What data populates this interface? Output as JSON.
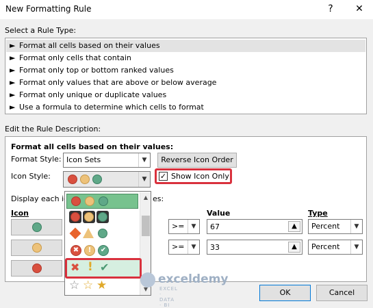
{
  "window": {
    "title": "New Formatting Rule",
    "help_glyph": "?",
    "close_glyph": "✕"
  },
  "rule_type": {
    "label": "Select a Rule Type:",
    "items": [
      "Format all cells based on their values",
      "Format only cells that contain",
      "Format only top or bottom ranked values",
      "Format only values that are above or below average",
      "Format only unique or duplicate values",
      "Use a formula to determine which cells to format"
    ],
    "arrow": "►",
    "selected_index": 0
  },
  "description": {
    "label": "Edit the Rule Description:",
    "heading": "Format all cells based on their values:",
    "format_style_label": "Format Style:",
    "format_style_value": "Icon Sets",
    "reverse_button": "Reverse Icon Order",
    "icon_style_label": "Icon Style:",
    "show_icon_only_label": "Show Icon Only",
    "show_icon_only_checked": true,
    "check_glyph": "✓",
    "display_partial_left": "Display each ic",
    "display_partial_right": "es:",
    "icon_col": "Icon",
    "value_col": "Value",
    "type_col": "Type",
    "rows": [
      {
        "op": ">=",
        "value": "67",
        "type": "Percent"
      },
      {
        "op": ">=",
        "value": "33",
        "type": "Percent"
      }
    ]
  },
  "icon_popup": {
    "options": [
      "3 Traffic Lights (Unrimmed)",
      "3 Traffic Lights (Rimmed)",
      "3 Signs",
      "3 Symbols (Circled)",
      "3 Symbols (Uncircled)",
      "3 Stars"
    ],
    "selected_index": 0,
    "highlighted_index": 4
  },
  "icons": {
    "dropdown": "chevron-down-icon",
    "up_arrow": "up-arrow-icon",
    "x_mark": "✖",
    "exclaim": "!",
    "check": "✔",
    "star_empty": "☆",
    "star_full": "★"
  },
  "watermark": {
    "name": "exceldemy",
    "tagline": "EXCEL · DATA · BI"
  },
  "footer": {
    "ok": "OK",
    "cancel": "Cancel"
  },
  "colors": {
    "red": "#d9503f",
    "yellow": "#edc27a",
    "green": "#5fa888",
    "highlight_border": "#d9313d"
  }
}
